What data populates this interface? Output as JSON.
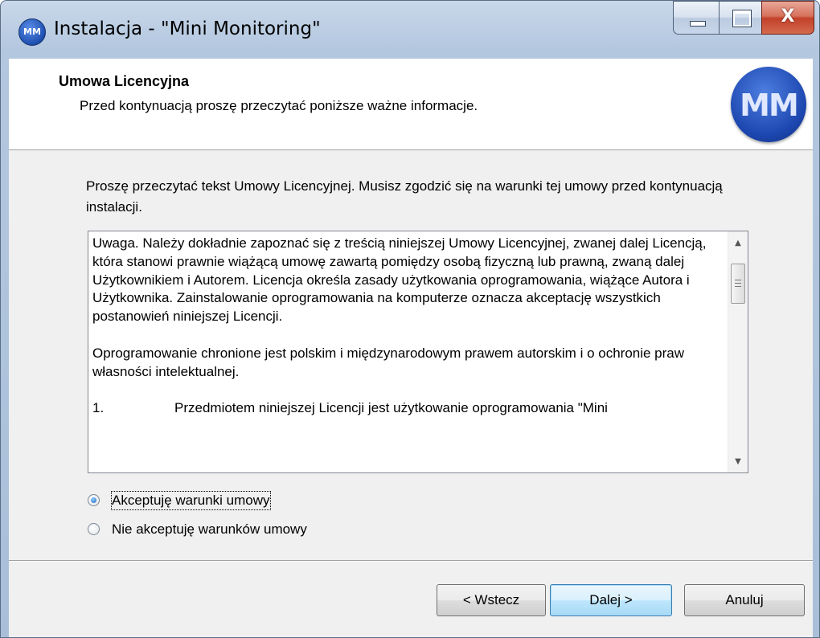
{
  "window": {
    "title": "Instalacja - \"Mini Monitoring\"",
    "app_icon_label": "MM",
    "close_glyph": "X"
  },
  "header": {
    "title": "Umowa Licencyjna",
    "subtitle": "Przed kontynuacją proszę przeczytać poniższe ważne informacje.",
    "logo_text": "MM"
  },
  "instructions": "Proszę przeczytać tekst Umowy Licencyjnej. Musisz zgodzić się na warunki tej umowy przed kontynuacją instalacji.",
  "license": {
    "paragraph1": "Uwaga. Należy dokładnie zapoznać się z treścią niniejszej Umowy Licencyjnej, zwanej dalej Licencją, która stanowi prawnie wiążącą umowę zawartą pomiędzy osobą fizyczną lub prawną, zwaną dalej Użytkownikiem i Autorem. Licencja określa zasady użytkowania oprogramowania, wiążące Autora i Użytkownika. Zainstalowanie oprogramowania na komputerze oznacza akceptację wszystkich postanowień niniejszej Licencji.",
    "paragraph2": "Oprogramowanie chronione jest polskim i międzynarodowym prawem autorskim i o ochronie praw własności intelektualnej.",
    "item1_number": "1.",
    "item1_text": "Przedmiotem niniejszej Licencji jest użytkowanie oprogramowania \"Mini"
  },
  "options": {
    "accept_label": "Akceptuję warunki umowy",
    "decline_label": "Nie akceptuję warunków umowy",
    "selected": "accept"
  },
  "buttons": {
    "back": "< Wstecz",
    "next": "Dalej >",
    "cancel": "Anuluj"
  },
  "colors": {
    "logo_blue": "#1d47b0",
    "close_red": "#c2412a",
    "default_button_border": "#3c7fb1"
  }
}
